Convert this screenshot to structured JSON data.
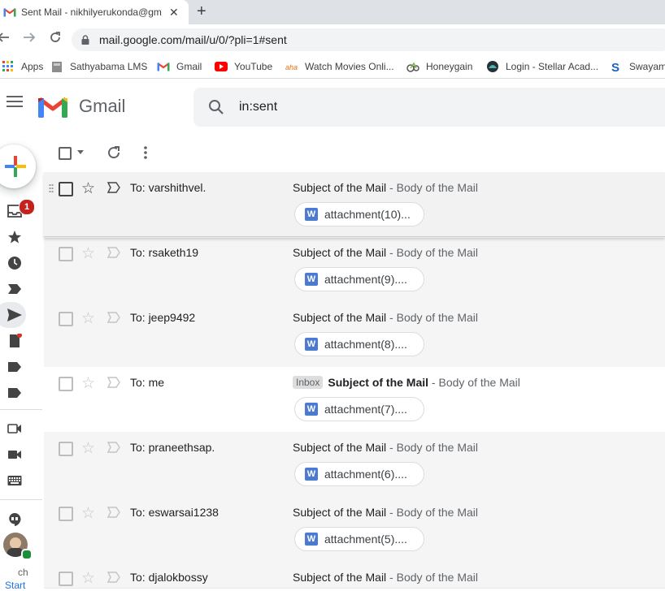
{
  "browser": {
    "tab_title": "Sent Mail - nikhilyerukonda@gm",
    "tab_close": "✕",
    "new_tab": "+",
    "url": "mail.google.com/mail/u/0/?pli=1#sent",
    "bookmarks": [
      {
        "label": "Apps",
        "icon": "apps-grid-icon"
      },
      {
        "label": "Sathyabama LMS",
        "icon": "sathyabama-icon"
      },
      {
        "label": "Gmail",
        "icon": "gmail-icon"
      },
      {
        "label": "YouTube",
        "icon": "youtube-icon"
      },
      {
        "label": "Watch Movies Onli...",
        "icon": "movies-icon"
      },
      {
        "label": "Honeygain",
        "icon": "honeygain-icon"
      },
      {
        "label": "Login - Stellar Acad...",
        "icon": "stellar-icon"
      },
      {
        "label": "Swayam",
        "icon": "swayam-icon"
      }
    ]
  },
  "gmail": {
    "product_name": "Gmail",
    "search_query": "in:sent",
    "unread_badge": "1",
    "bottom_text": "ch",
    "bottom_link": "Start"
  },
  "emails": [
    {
      "to": "To: varshithvel.",
      "subject": "Subject of the Mail",
      "separator": " - ",
      "body": "Body of the Mail",
      "attachment": "attachment(10)...",
      "label": ""
    },
    {
      "to": "To: rsaketh19",
      "subject": "Subject of the Mail",
      "separator": " - ",
      "body": "Body of the Mail",
      "attachment": "attachment(9)....",
      "label": ""
    },
    {
      "to": "To: jeep9492",
      "subject": "Subject of the Mail",
      "separator": " - ",
      "body": "Body of the Mail",
      "attachment": "attachment(8)....",
      "label": ""
    },
    {
      "to": "To: me",
      "subject": "Subject of the Mail",
      "separator": " - ",
      "body": "Body of the Mail",
      "attachment": "attachment(7)....",
      "label": "Inbox"
    },
    {
      "to": "To: praneethsap.",
      "subject": "Subject of the Mail",
      "separator": " - ",
      "body": "Body of the Mail",
      "attachment": "attachment(6)....",
      "label": ""
    },
    {
      "to": "To: eswarsai1238",
      "subject": "Subject of the Mail",
      "separator": " - ",
      "body": "Body of the Mail",
      "attachment": "attachment(5)....",
      "label": ""
    },
    {
      "to": "To: djalokbossy",
      "subject": "Subject of the Mail",
      "separator": " - ",
      "body": "Body of the Mail",
      "attachment": "",
      "label": ""
    }
  ],
  "colors": {
    "accent_red": "#c5221f",
    "doc_blue": "#4a7bd0"
  }
}
